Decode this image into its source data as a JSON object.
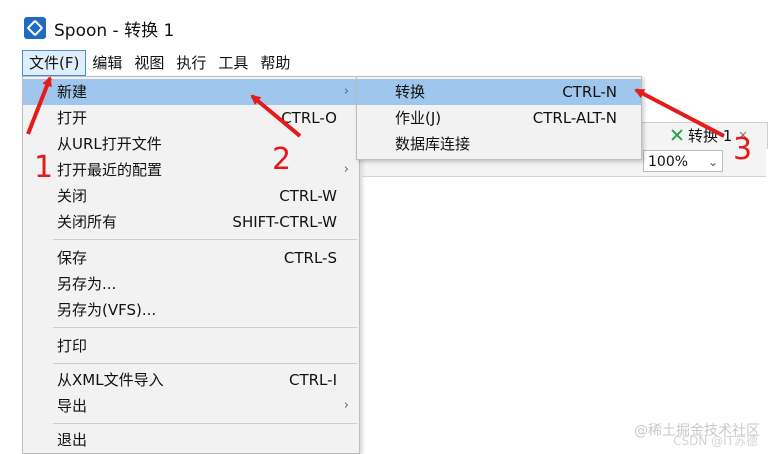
{
  "window": {
    "title": "Spoon - 转换 1"
  },
  "menubar": [
    "文件(F)",
    "编辑",
    "视图",
    "执行",
    "工具",
    "帮助"
  ],
  "file_menu": {
    "items": [
      {
        "label": "新建",
        "shortcut": "",
        "submenu": true
      },
      {
        "label": "打开",
        "shortcut": "CTRL-O"
      },
      {
        "label": "从URL打开文件",
        "shortcut": ""
      },
      {
        "label": "打开最近的配置",
        "shortcut": "",
        "submenu": true
      },
      {
        "label": "关闭",
        "shortcut": "CTRL-W"
      },
      {
        "label": "关闭所有",
        "shortcut": "SHIFT-CTRL-W"
      },
      {
        "label": "保存",
        "shortcut": "CTRL-S"
      },
      {
        "label": "另存为...",
        "shortcut": ""
      },
      {
        "label": "另存为(VFS)...",
        "shortcut": ""
      },
      {
        "label": "打印",
        "shortcut": ""
      },
      {
        "label": "从XML文件导入",
        "shortcut": "CTRL-I"
      },
      {
        "label": "导出",
        "shortcut": "",
        "submenu": true
      },
      {
        "label": "退出",
        "shortcut": ""
      }
    ]
  },
  "new_submenu": {
    "items": [
      {
        "label": "转换",
        "shortcut": "CTRL-N"
      },
      {
        "label": "作业(J)",
        "shortcut": "CTRL-ALT-N"
      },
      {
        "label": "数据库连接",
        "shortcut": ""
      }
    ]
  },
  "editor": {
    "tab_label": "转换 1",
    "zoom": "100%"
  },
  "annotations": [
    "1",
    "2",
    "3"
  ],
  "watermark": "@稀土掘金技术社区",
  "watermark2": "CSDN @IT苏德"
}
